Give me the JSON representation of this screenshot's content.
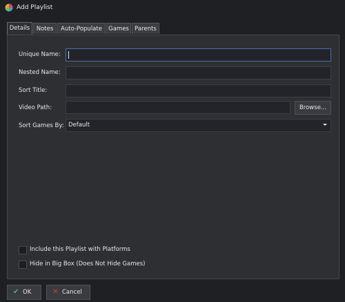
{
  "window": {
    "title": "Add Playlist",
    "app_icon": "launchbox-icon"
  },
  "tabs": [
    {
      "label": "Details",
      "active": true
    },
    {
      "label": "Notes",
      "active": false
    },
    {
      "label": "Auto-Populate",
      "active": false
    },
    {
      "label": "Games",
      "active": false
    },
    {
      "label": "Parents",
      "active": false
    }
  ],
  "form": {
    "unique_name": {
      "label": "Unique Name:",
      "value": ""
    },
    "nested_name": {
      "label": "Nested Name:",
      "value": ""
    },
    "sort_title": {
      "label": "Sort Title:",
      "value": ""
    },
    "video_path": {
      "label": "Video Path:",
      "value": "",
      "browse_label": "Browse..."
    },
    "sort_games_by": {
      "label": "Sort Games By:",
      "value": "Default"
    }
  },
  "options": {
    "include_with_platforms": {
      "label": "Include this Playlist with Platforms",
      "checked": false
    },
    "hide_in_big_box": {
      "label": "Hide in Big Box (Does Not Hide Games)",
      "checked": false
    }
  },
  "buttons": {
    "ok": {
      "label": "OK",
      "icon": "checkmark-icon",
      "icon_color": "#4cc24a"
    },
    "cancel": {
      "label": "Cancel",
      "icon": "cross-icon",
      "icon_color": "#d83a3a"
    }
  }
}
